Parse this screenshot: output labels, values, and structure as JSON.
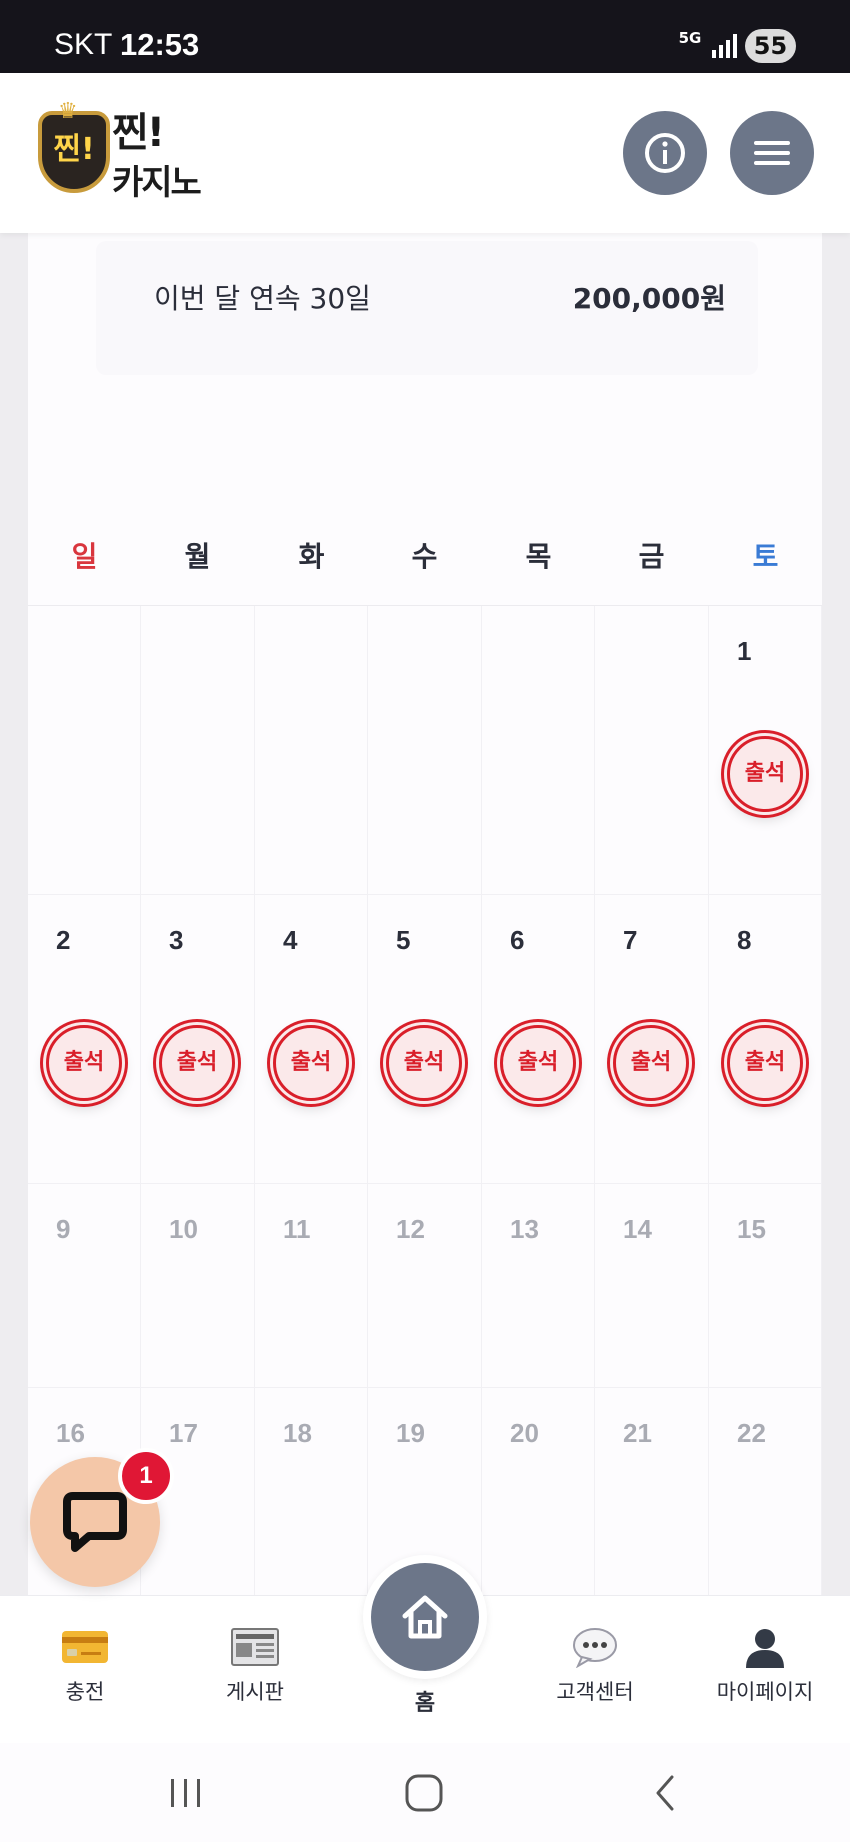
{
  "status_bar": {
    "carrier": "SKT",
    "time": "12:53",
    "network": "5G",
    "battery": "55"
  },
  "header": {
    "logo_line1": "찐!",
    "logo_line2": "카지노",
    "logo_badge": "찐!"
  },
  "reward": {
    "label": "이번 달 연속 30일",
    "value": "200,000원"
  },
  "calendar": {
    "weekdays": [
      "일",
      "월",
      "화",
      "수",
      "목",
      "금",
      "토"
    ],
    "stamp_label": "출석",
    "days": [
      "1",
      "2",
      "3",
      "4",
      "5",
      "6",
      "7",
      "8",
      "9",
      "10",
      "11",
      "12",
      "13",
      "14",
      "15",
      "16",
      "17",
      "18",
      "19",
      "20",
      "21",
      "22"
    ],
    "attended_days": [
      1,
      2,
      3,
      4,
      5,
      6,
      7,
      8
    ]
  },
  "chat": {
    "badge_count": "1"
  },
  "bottom_nav": {
    "charge": "충전",
    "board": "게시판",
    "home": "홈",
    "support": "고객센터",
    "mypage": "마이페이지"
  }
}
